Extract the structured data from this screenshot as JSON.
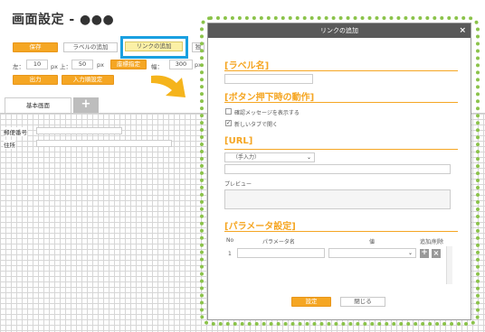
{
  "page": {
    "title": "画面設定 - ●●●"
  },
  "toolbar": {
    "save_label": "保存",
    "add_label_label": "ラベルの追加",
    "add_link_label": "リンクの追加",
    "extra_label": "独",
    "output_label": "出力",
    "input_order_label": "入力順設定",
    "coord_label": "座標指定",
    "left_label": "左：",
    "left_value": "10",
    "top_label": "px 上：",
    "top_value": "50",
    "px_label": "px",
    "width_label": "幅：",
    "width_value": "300",
    "width_px": "px"
  },
  "tabs": {
    "main_label": "基本画面",
    "add_label": "+"
  },
  "canvas": {
    "postal_label": "郵便番号",
    "address_label": "住所"
  },
  "modal": {
    "title": "リンクの追加",
    "close": "×",
    "label_section": "[ラベル名]",
    "action_section": "[ボタン押下時の動作]",
    "confirm_message": "確認メッセージを表示する",
    "open_new_tab": "新しいタブで開く",
    "confirm_checked": false,
    "new_tab_checked": true,
    "url_section": "[URL]",
    "url_select_value": "（手入力）",
    "preview_label": "プレビュー",
    "param_section": "[パラメータ設定]",
    "col_no": "No",
    "col_param": "パラメータ名",
    "col_value": "値",
    "col_add_del": "追加/削除",
    "row_no": "1",
    "add_btn": "+",
    "del_btn": "×",
    "ok_label": "設定",
    "close_label": "閉じる"
  },
  "colors": {
    "accent": "#f5a623",
    "highlight": "#1aa0e0",
    "frame": "#8bc34a",
    "header": "#595959"
  }
}
